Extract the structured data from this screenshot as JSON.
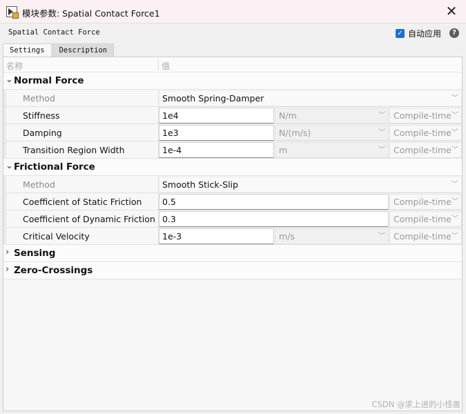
{
  "window": {
    "title": "模块参数: Spatial Contact Force1"
  },
  "header": {
    "block_name": "Spatial Contact Force",
    "auto_apply_label": "自动应用",
    "auto_apply_checked": true
  },
  "tabs": [
    {
      "label": "Settings",
      "active": true
    },
    {
      "label": "Description",
      "active": false
    }
  ],
  "table": {
    "col_name": "名称",
    "col_value": "值"
  },
  "sections": {
    "normal": {
      "label": "Normal Force",
      "method": {
        "label": "Method",
        "value": "Smooth Spring-Damper"
      },
      "stiffness": {
        "label": "Stiffness",
        "value": "1e4",
        "unit": "N/m",
        "config": "Compile-time"
      },
      "damping": {
        "label": "Damping",
        "value": "1e3",
        "unit": "N/(m/s)",
        "config": "Compile-time"
      },
      "transition": {
        "label": "Transition Region Width",
        "value": "1e-4",
        "unit": "m",
        "config": "Compile-time"
      }
    },
    "friction": {
      "label": "Frictional Force",
      "method": {
        "label": "Method",
        "value": "Smooth Stick-Slip"
      },
      "static": {
        "label": "Coefficient of Static Friction",
        "value": "0.5",
        "config": "Compile-time"
      },
      "dynamic": {
        "label": "Coefficient of Dynamic Friction",
        "value": "0.3",
        "config": "Compile-time"
      },
      "velocity": {
        "label": "Critical Velocity",
        "value": "1e-3",
        "unit": "m/s",
        "config": "Compile-time"
      }
    },
    "sensing": {
      "label": "Sensing"
    },
    "zero": {
      "label": "Zero-Crossings"
    }
  },
  "watermark": "CSDN @求上进的小怪兽",
  "colors": {
    "accent": "#1a6fd1"
  }
}
